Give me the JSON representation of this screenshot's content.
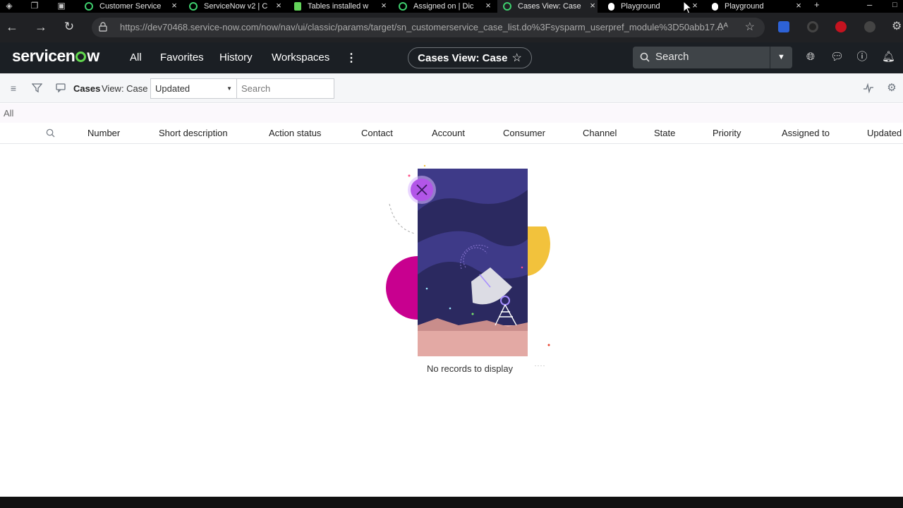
{
  "browser": {
    "tabs": [
      {
        "title": "Customer Service",
        "favicon": "green-ring-icon"
      },
      {
        "title": "ServiceNow v2 | C",
        "favicon": "green-drop-icon"
      },
      {
        "title": "Tables installed w",
        "favicon": "doc-icon"
      },
      {
        "title": "Assigned on | Dic",
        "favicon": "green-ring-icon"
      },
      {
        "title": "Cases View: Case",
        "favicon": "green-ring-icon",
        "active": true
      },
      {
        "title": "Playground",
        "favicon": "white-drop-icon"
      },
      {
        "title": "Playground",
        "favicon": "white-drop-icon"
      }
    ],
    "url": "https://dev70468.service-now.com/now/nav/ui/classic/params/target/sn_customerservice_case_list.do%3Fsysparm_userpref_module%3D50abb17..."
  },
  "header": {
    "logo": "servicenow",
    "nav": [
      "All",
      "Favorites",
      "History",
      "Workspaces"
    ],
    "context_title": "Cases View: Case",
    "search_placeholder": "Search"
  },
  "list": {
    "title": "Cases",
    "view": "View: Case",
    "filter_field": "Updated",
    "search_placeholder": "Search",
    "breadcrumb": "All",
    "columns": [
      "Number",
      "Short description",
      "Action status",
      "Contact",
      "Account",
      "Consumer",
      "Channel",
      "State",
      "Priority",
      "Assigned to",
      "Updated"
    ],
    "empty_message": "No records to display"
  },
  "colors": {
    "header_bg": "#1b1f24",
    "accent_green": "#62d84e",
    "illus_purple": "#2e2a6b",
    "illus_magenta": "#c8008f",
    "illus_yellow": "#f2c23c"
  }
}
